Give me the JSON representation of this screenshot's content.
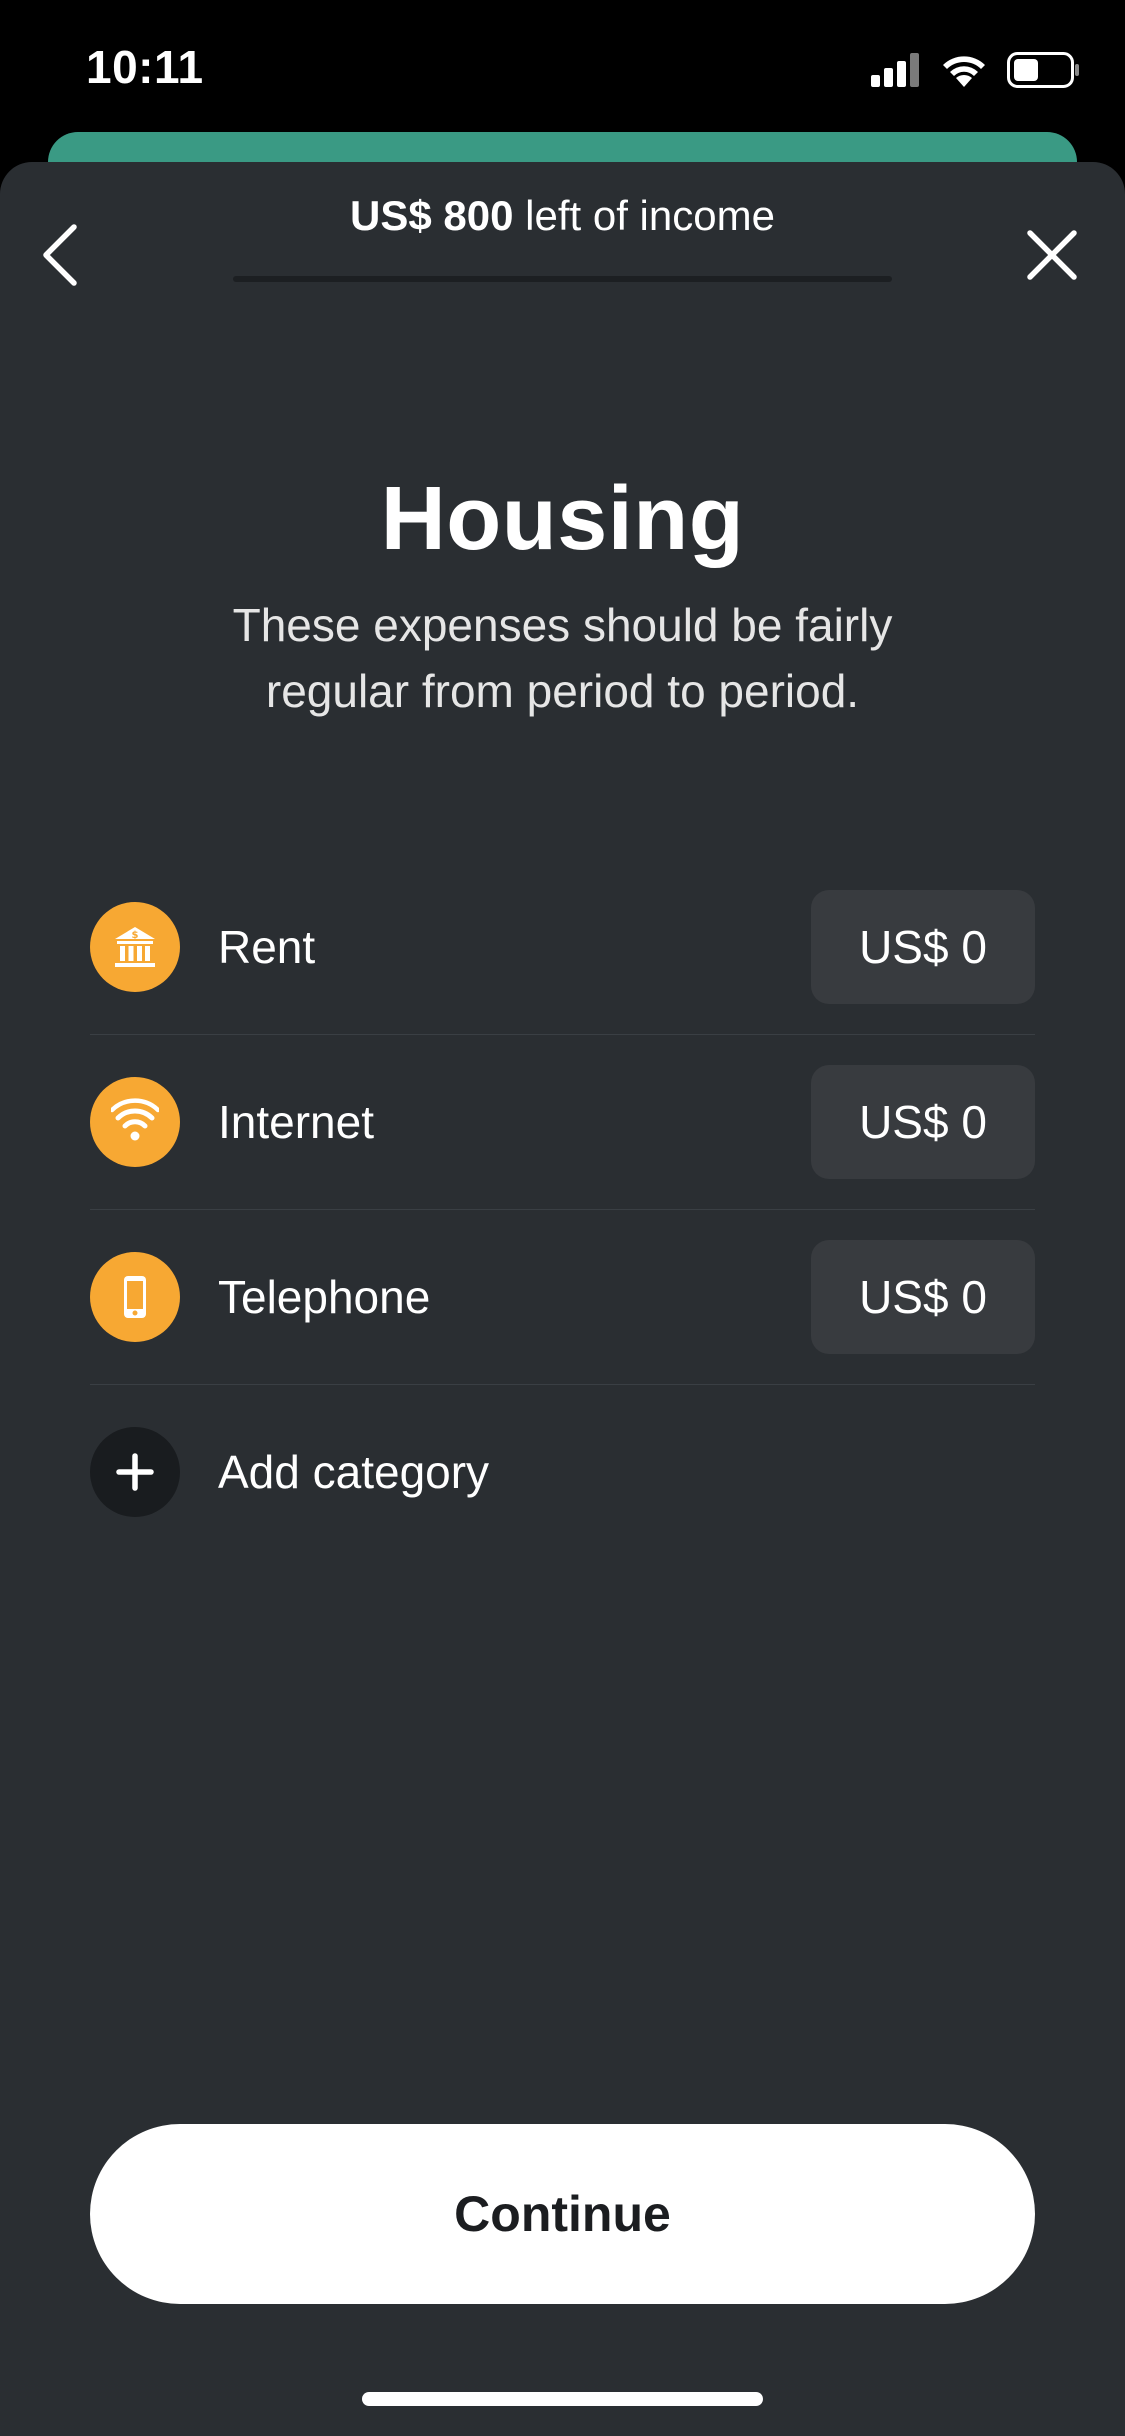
{
  "status_bar": {
    "time": "10:11",
    "icons": [
      "cellular-signal-icon",
      "wifi-icon",
      "battery-icon"
    ]
  },
  "header": {
    "income_amount": "US$ 800",
    "income_suffix": " left of income",
    "back_icon": "chevron-left-icon",
    "close_icon": "close-icon"
  },
  "page": {
    "title": "Housing",
    "subtitle": "These expenses should be fairly regular from period to period."
  },
  "categories": [
    {
      "label": "Rent",
      "amount": "US$ 0",
      "icon": "bank-icon"
    },
    {
      "label": "Internet",
      "amount": "US$ 0",
      "icon": "wifi-icon"
    },
    {
      "label": "Telephone",
      "amount": "US$ 0",
      "icon": "phone-icon"
    }
  ],
  "add_category": {
    "label": "Add category",
    "icon": "plus-icon"
  },
  "footer": {
    "continue_label": "Continue"
  },
  "colors": {
    "sheet_background": "#2a2e32",
    "accent_orange": "#f7a833",
    "peek_card_green": "#3a9a84",
    "field_background": "#383b3f"
  }
}
